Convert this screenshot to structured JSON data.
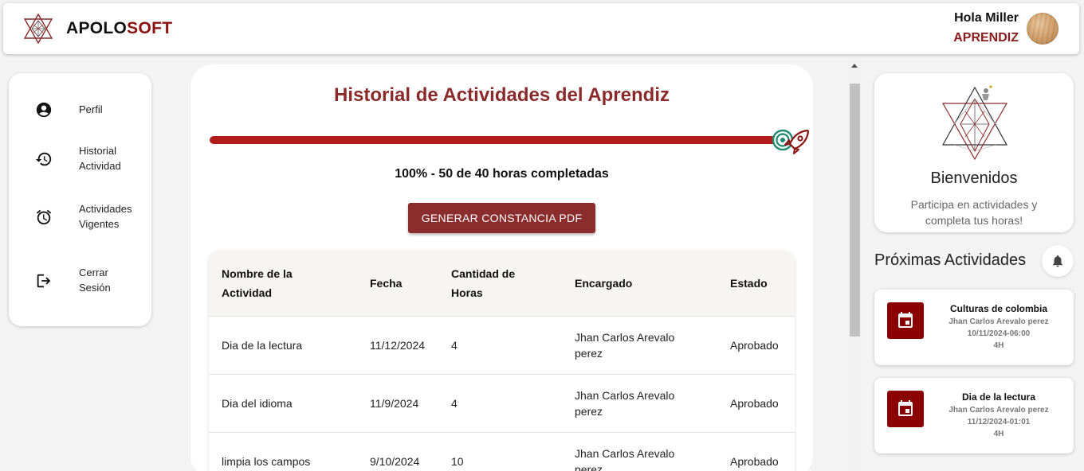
{
  "header": {
    "brand_part1": "APOLO",
    "brand_part2": "SOFT",
    "greeting": "Hola Miller",
    "role": "APRENDIZ"
  },
  "sidebar": {
    "items": [
      {
        "label_line1": "Perfil",
        "label_line2": "",
        "icon": "account-circle-icon"
      },
      {
        "label_line1": "Historial",
        "label_line2": "Actividad",
        "icon": "history-icon"
      },
      {
        "label_line1": "Actividades",
        "label_line2": "Vigentes",
        "icon": "alarm-icon"
      },
      {
        "label_line1": "Cerrar",
        "label_line2": "Sesión",
        "icon": "logout-icon"
      }
    ]
  },
  "main": {
    "title": "Historial de Actividades del Aprendiz",
    "progress_percent": 100,
    "progress_text": "100% - 50 de 40 horas completadas",
    "pdf_button": "GENERAR CONSTANCIA PDF",
    "table": {
      "headers": [
        "Nombre de la Actividad",
        "Fecha",
        "Cantidad de Horas",
        "Encargado",
        "Estado"
      ],
      "rows": [
        [
          "Dia de la lectura",
          "11/12/2024",
          "4",
          "Jhan Carlos Arevalo perez",
          "Aprobado"
        ],
        [
          "Dia del idioma",
          "11/9/2024",
          "4",
          "Jhan Carlos Arevalo perez",
          "Aprobado"
        ],
        [
          "limpia los campos",
          "9/10/2024",
          "10",
          "Jhan Carlos Arevalo perez",
          "Aprobado"
        ]
      ]
    }
  },
  "welcome": {
    "title": "Bienvenidos",
    "subtitle_line1": "Participa en actividades y",
    "subtitle_line2": "completa tus horas!"
  },
  "upcoming": {
    "title": "Próximas Actividades",
    "items": [
      {
        "name": "Culturas de colombia",
        "person": "Jhan Carlos Arevalo perez",
        "datetime": "10/11/2024-06:00",
        "hours": "4H"
      },
      {
        "name": "Dia de la lectura",
        "person": "Jhan Carlos Arevalo perez",
        "datetime": "11/12/2024-01:01",
        "hours": "4H"
      }
    ]
  },
  "colors": {
    "brand_red": "#8b1010",
    "button_red": "#8b2d2d",
    "progress_red": "#b01c1c",
    "title_red": "#8b2a2a",
    "calendar_bg": "#8b0000"
  }
}
